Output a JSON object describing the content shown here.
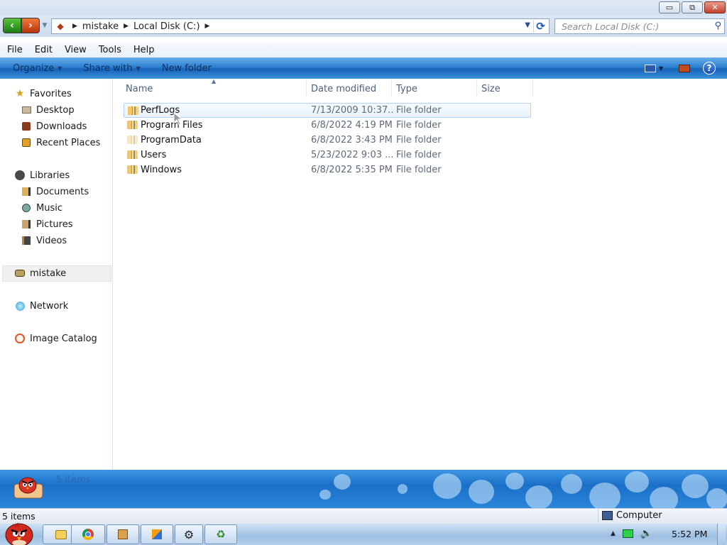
{
  "window": {
    "controls": {
      "minimize": "▭",
      "maximize": "⧉",
      "close": "✕"
    }
  },
  "address_bar": {
    "crumbs": [
      "mistake",
      "Local Disk (C:)"
    ],
    "refresh_icon": "refresh-icon"
  },
  "search": {
    "placeholder": "Search Local Disk (C:)"
  },
  "menu": [
    "File",
    "Edit",
    "View",
    "Tools",
    "Help"
  ],
  "toolbar": {
    "organize": "Organize",
    "share_with": "Share with",
    "new_folder": "New folder"
  },
  "nav": {
    "favorites_label": "Favorites",
    "favorites": [
      "Desktop",
      "Downloads",
      "Recent Places"
    ],
    "libraries_label": "Libraries",
    "libraries": [
      "Documents",
      "Music",
      "Pictures",
      "Videos"
    ],
    "homegroup": "mistake",
    "network": "Network",
    "catalog": "Image Catalog"
  },
  "columns": {
    "name": "Name",
    "date": "Date modified",
    "type": "Type",
    "size": "Size"
  },
  "files": [
    {
      "name": "PerfLogs",
      "date": "7/13/2009 10:37...",
      "type": "File folder",
      "size": ""
    },
    {
      "name": "Program Files",
      "date": "6/8/2022 4:19 PM",
      "type": "File folder",
      "size": ""
    },
    {
      "name": "ProgramData",
      "date": "6/8/2022 3:43 PM",
      "type": "File folder",
      "size": ""
    },
    {
      "name": "Users",
      "date": "5/23/2022 9:03 ...",
      "type": "File folder",
      "size": ""
    },
    {
      "name": "Windows",
      "date": "6/8/2022 5:35 PM",
      "type": "File folder",
      "size": ""
    }
  ],
  "details": {
    "count": "5 items"
  },
  "status": {
    "left": "5 items",
    "right": "Computer"
  },
  "taskbar": {
    "clock": "5:52 PM"
  },
  "colors": {
    "accent": "#1662b8",
    "hover_border": "#b6d3f2"
  }
}
